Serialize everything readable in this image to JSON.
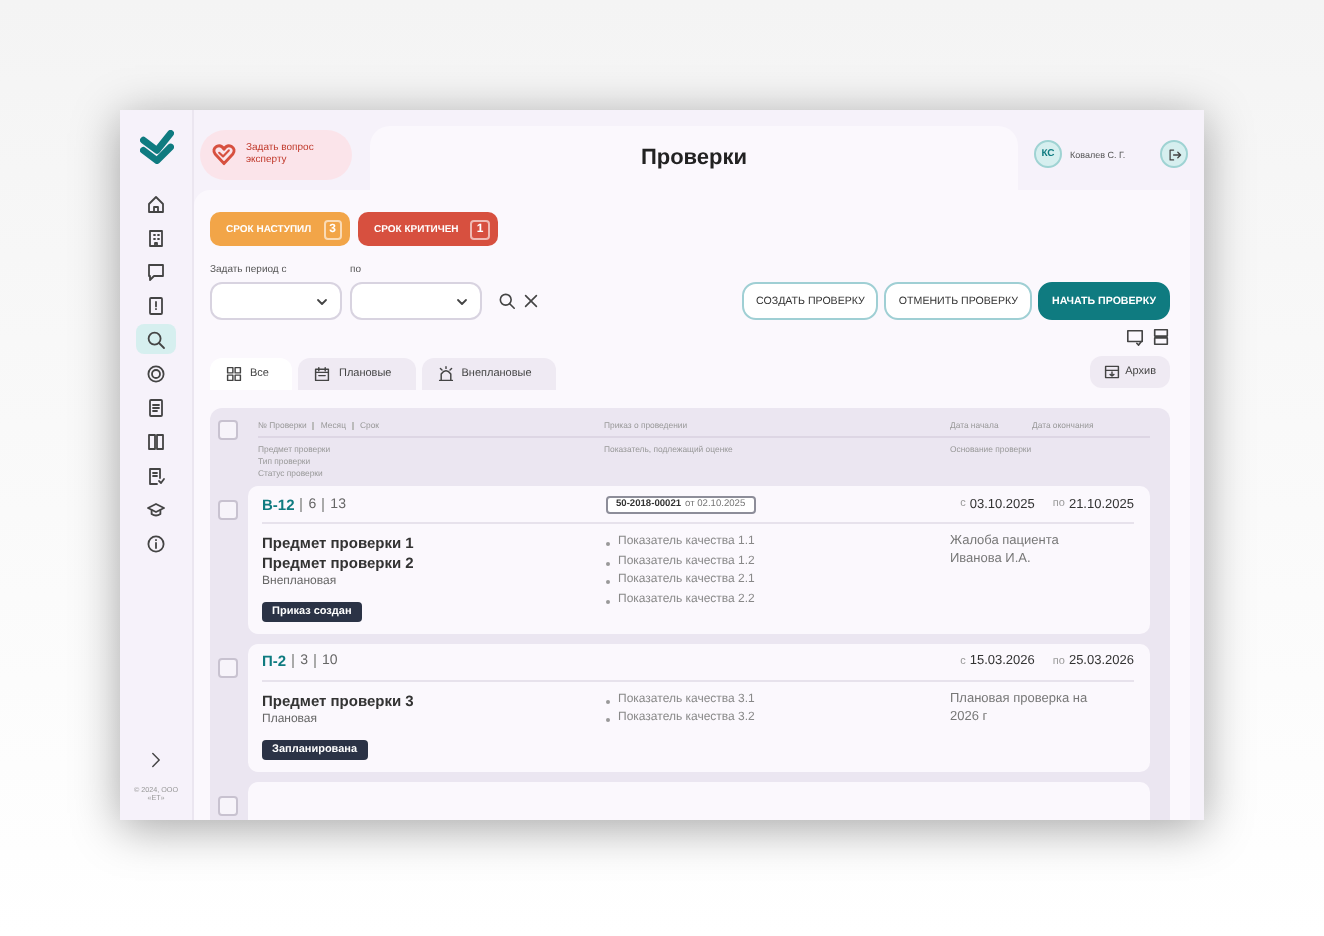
{
  "sidebar": {
    "items": [
      {
        "selected": false
      },
      {
        "selected": false
      },
      {
        "selected": false
      },
      {
        "selected": false
      },
      {
        "selected": true
      },
      {
        "selected": false
      },
      {
        "selected": false
      },
      {
        "selected": false
      },
      {
        "selected": false
      },
      {
        "selected": false
      },
      {
        "selected": false
      }
    ],
    "footer": "© 2024, ООО «ЕТ»"
  },
  "expert_button": {
    "label": "Задать вопрос эксперту"
  },
  "title": "Проверки",
  "user": {
    "initials": "КС",
    "name": "Ковалев С. Г."
  },
  "deadline_badges": [
    {
      "label": "СРОК НАСТУПИЛ",
      "count": "3",
      "color": "#f2a548"
    },
    {
      "label": "СРОК КРИТИЧЕН",
      "count": "1",
      "color": "#d7503f"
    }
  ],
  "period_filter": {
    "from_label": "Задать период с",
    "to_label": "по"
  },
  "actions": [
    {
      "label": "СОЗДАТЬ ПРОВЕРКУ",
      "kind": "outline"
    },
    {
      "label": "ОТМЕНИТЬ ПРОВЕРКУ",
      "kind": "outline"
    },
    {
      "label": "НАЧАТЬ ПРОВЕРКУ",
      "kind": "primary"
    }
  ],
  "tabs": [
    {
      "label": "Все",
      "selected": true
    },
    {
      "label": "Плановые",
      "selected": false
    },
    {
      "label": "Внеплановые",
      "selected": false
    }
  ],
  "archive_button": {
    "label": "Архив"
  },
  "table": {
    "header_checked": false,
    "columns": {
      "code": "№ Проверки",
      "month": "Месяц",
      "term": "Срок",
      "order": "Приказ о проведении",
      "start": "Дата начала",
      "end": "Дата окончания",
      "subject": "Предмет проверки",
      "type": "Тип проверки",
      "status": "Статус проверки",
      "indicators": "Показатель, подлежащий оценке",
      "basis": "Основание проверки"
    },
    "rows": [
      {
        "checked": false,
        "code": "В-12",
        "month": "6",
        "term": "13",
        "order_number": "50-2018-00021",
        "order_date": "от 02.10.2025",
        "from": "с",
        "start": "03.10.2025",
        "to": "по",
        "end": "21.10.2025",
        "subjects": [
          "Предмет проверки 1",
          "Предмет проверки 2"
        ],
        "type": "Внеплановая",
        "status": "Приказ создан",
        "indicators": [
          "Показатель качества 1.1",
          "Показатель качества 1.2",
          "Показатель качества 2.1",
          "Показатель качества 2.2"
        ],
        "basis": "Жалоба пациента Иванова И.А."
      },
      {
        "checked": false,
        "code": "П-2",
        "month": "3",
        "term": "10",
        "from": "с",
        "start": "15.03.2026",
        "to": "по",
        "end": "25.03.2026",
        "subjects": [
          "Предмет проверки 3"
        ],
        "type": "Плановая",
        "status": "Запланирована",
        "indicators": [
          "Показатель качества 3.1",
          "Показатель качества 3.2"
        ],
        "basis": "Плановая проверка на 2026 г"
      },
      {
        "checked": false
      }
    ]
  }
}
